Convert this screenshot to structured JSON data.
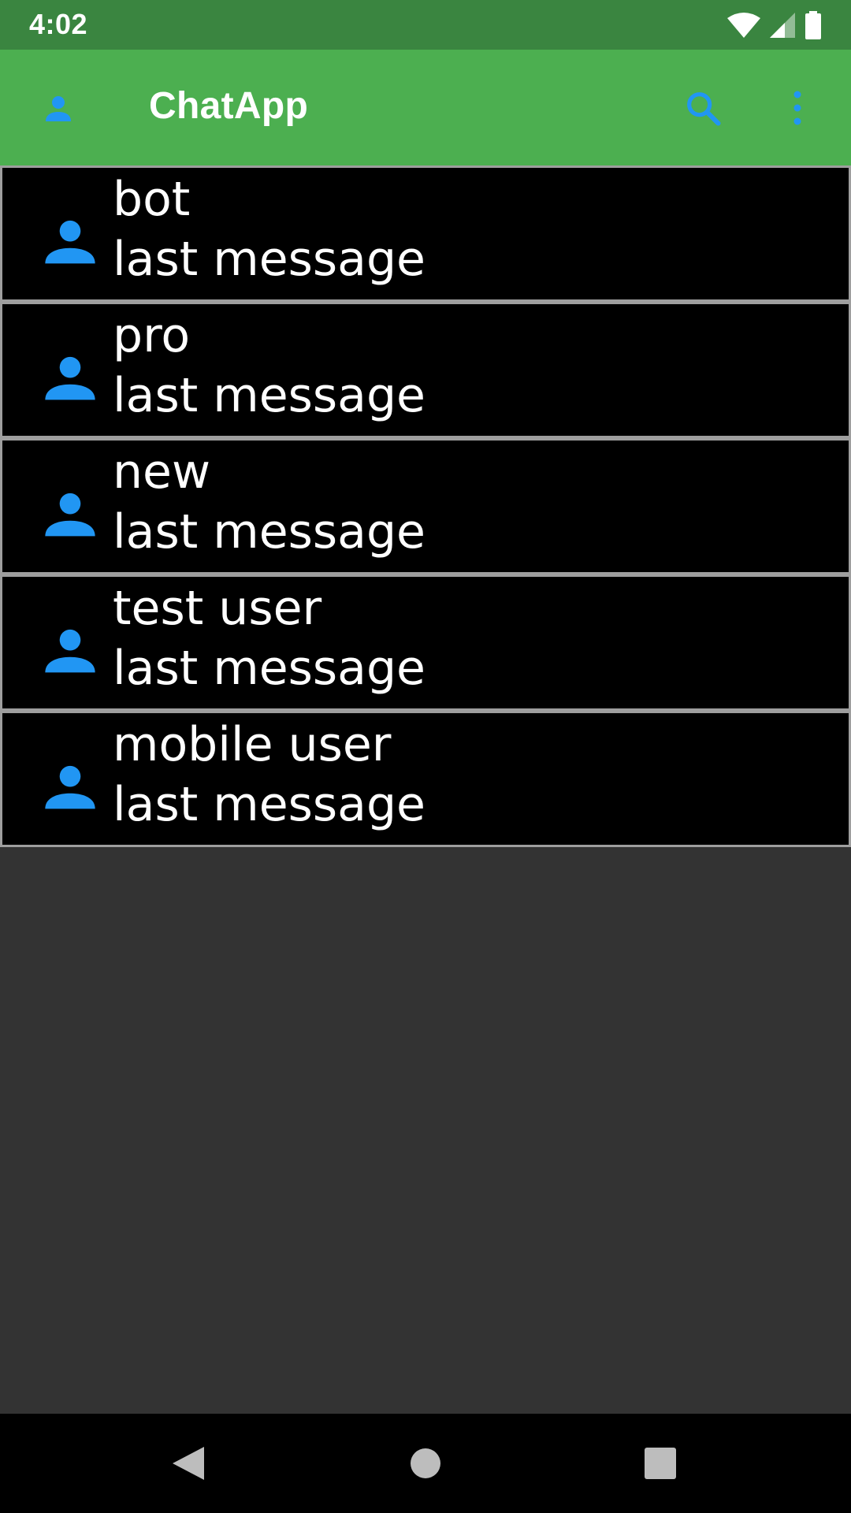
{
  "status_bar": {
    "time": "4:02",
    "icons": [
      "wifi-icon",
      "cell-signal-icon",
      "battery-icon"
    ]
  },
  "app_bar": {
    "title": "ChatApp",
    "icons": {
      "profile": "person-icon",
      "search": "search-icon",
      "menu": "more-vert-icon"
    },
    "icon_color": "#2196f3",
    "background": "#4caf50"
  },
  "chats": [
    {
      "name": "bot",
      "last_message": "last message"
    },
    {
      "name": "pro",
      "last_message": "last message"
    },
    {
      "name": "new",
      "last_message": "last message"
    },
    {
      "name": "test user",
      "last_message": "last message"
    },
    {
      "name": "mobile user",
      "last_message": "last message"
    }
  ],
  "nav_bar": {
    "icons": [
      "back-icon",
      "home-icon",
      "recents-icon"
    ]
  }
}
